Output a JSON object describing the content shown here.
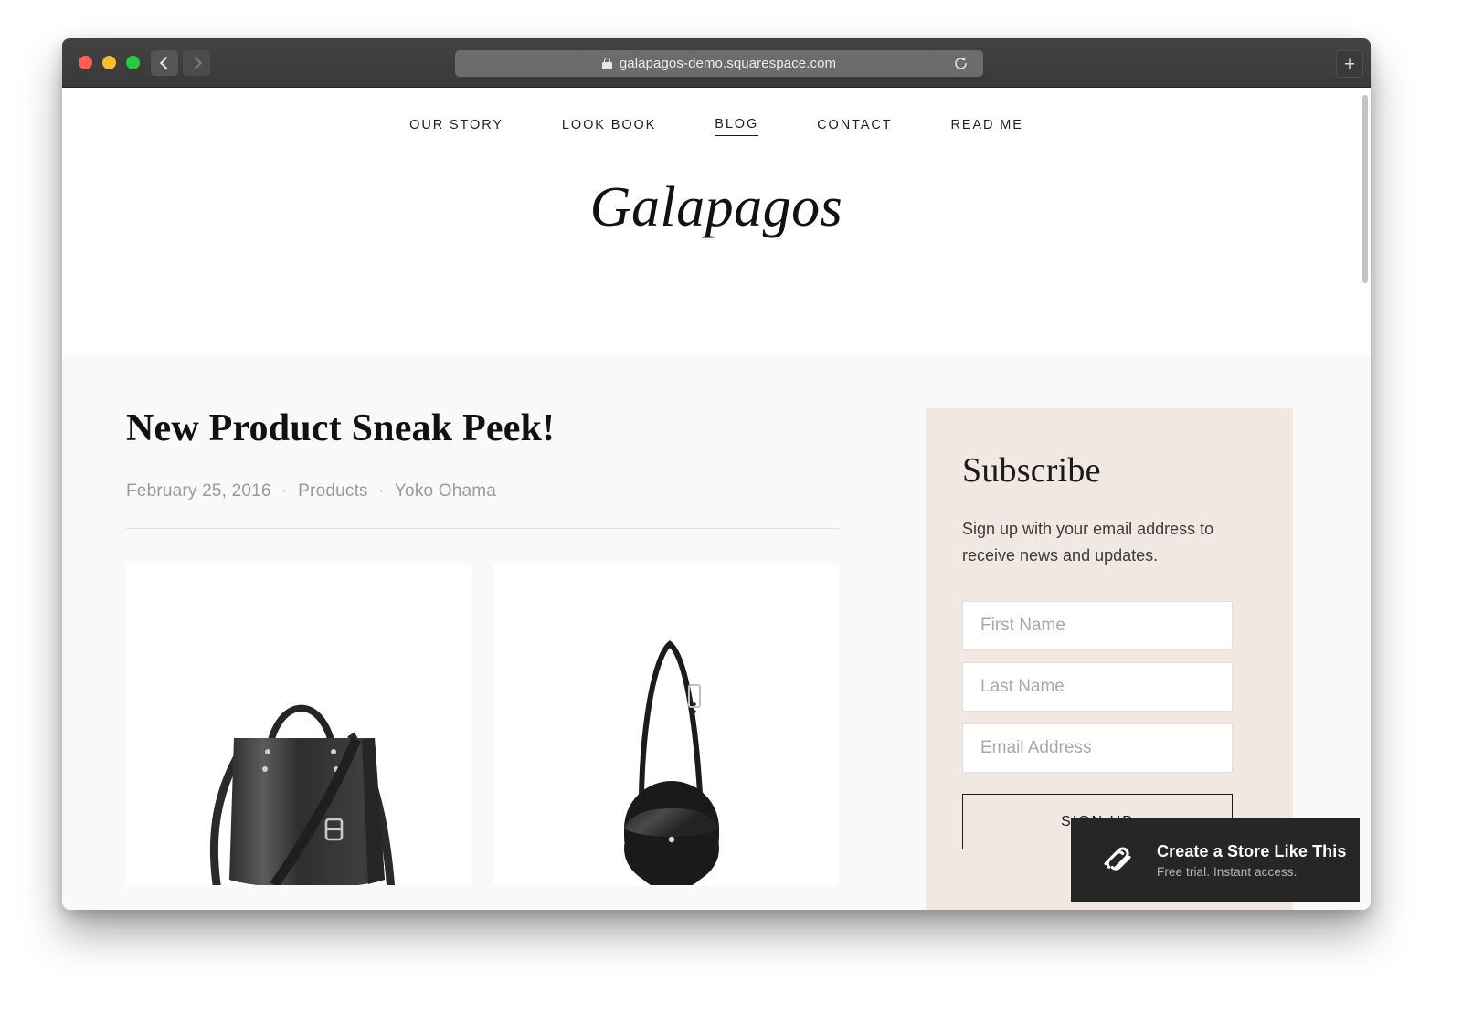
{
  "browser": {
    "url": "galapagos-demo.squarespace.com",
    "lock_icon": "lock-icon",
    "reload_icon": "reload-icon",
    "back_icon": "chevron-left-icon",
    "forward_icon": "chevron-right-icon",
    "new_tab_label": "+",
    "traffic_lights": [
      {
        "name": "close",
        "color": "#ff5f57"
      },
      {
        "name": "minimize",
        "color": "#ffbd2e"
      },
      {
        "name": "maximize",
        "color": "#28c840"
      }
    ]
  },
  "site": {
    "logo": "Galapagos",
    "nav": [
      {
        "label": "OUR STORY",
        "active": false
      },
      {
        "label": "LOOK BOOK",
        "active": false
      },
      {
        "label": "BLOG",
        "active": true
      },
      {
        "label": "CONTACT",
        "active": false
      },
      {
        "label": "READ ME",
        "active": false
      }
    ]
  },
  "post": {
    "title": "New Product Sneak Peek!",
    "date": "February 25, 2016",
    "category": "Products",
    "author": "Yoko Ohama",
    "separator": "·",
    "images": [
      {
        "name": "black-leather-tote-bag",
        "alt": "Black leather tote bag with crossbody strap"
      },
      {
        "name": "black-half-moon-crossbody-bag",
        "alt": "Black half-moon crossbody bag with long strap"
      }
    ]
  },
  "subscribe": {
    "title": "Subscribe",
    "description": "Sign up with your email address to receive news and updates.",
    "fields": [
      {
        "name": "first-name-field",
        "placeholder": "First Name",
        "value": ""
      },
      {
        "name": "last-name-field",
        "placeholder": "Last Name",
        "value": ""
      },
      {
        "name": "email-address-field",
        "placeholder": "Email Address",
        "value": ""
      }
    ],
    "button_label": "SIGN UP",
    "panel_color": "#f2e8e2"
  },
  "banner": {
    "title": "Create a Store Like This",
    "subtitle": "Free trial. Instant access.",
    "logo_icon": "squarespace-logo-icon",
    "background": "#262626"
  }
}
